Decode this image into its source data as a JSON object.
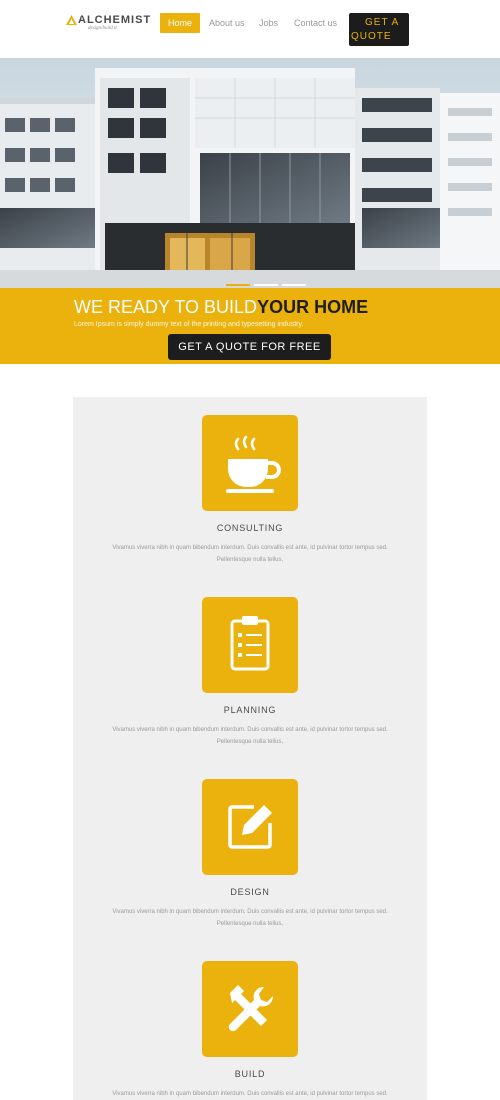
{
  "header": {
    "logo_name": "ALCHEMIST",
    "logo_tagline": "design/build it",
    "nav": [
      {
        "label": "Home",
        "active": true
      },
      {
        "label": "About us",
        "active": false
      },
      {
        "label": "Jobs",
        "active": false
      },
      {
        "label": "Contact us",
        "active": false
      }
    ],
    "quote_line1": "GET A",
    "quote_line2": "QUOTE"
  },
  "hero": {
    "image_desc_icon": "building-photo",
    "slide_indicators": 3
  },
  "banner": {
    "title_light": "WE READY TO BUILD",
    "title_dark": "YOUR HOME",
    "subtitle": "Lorem Ipsum is simply dummy text of the printing and typesetting industry.",
    "cta": "GET A QUOTE FOR FREE"
  },
  "services": [
    {
      "icon": "coffee-cup-icon",
      "title": "CONSULTING",
      "desc_line1": "Vivamus viverra nibh in quam bibendum interdum. Duis convallis est ante, id pulvinar tortor tempus sed.",
      "desc_line2": "Pellentesque nulla tellus,"
    },
    {
      "icon": "clipboard-icon",
      "title": "PLANNING",
      "desc_line1": "Vivamus viverra nibh in quam bibendum interdum. Duis convallis est ante, id pulvinar tortor tempus sed.",
      "desc_line2": "Pellentesque nulla tellus,"
    },
    {
      "icon": "edit-pencil-icon",
      "title": "DESIGN",
      "desc_line1": "Vivamus viverra nibh in quam bibendum interdum. Duis convallis est ante, id pulvinar tortor tempus sed.",
      "desc_line2": "Pellentesque nulla tellus,"
    },
    {
      "icon": "tools-icon",
      "title": "BUILD",
      "desc_line1": "Vivamus viverra nibh in quam bibendum interdum. Duis convallis est ante, id pulvinar tortor tempus sed.",
      "desc_line2": ""
    }
  ],
  "colors": {
    "accent": "#ebb10c",
    "dark": "#1d1d1d",
    "panel": "#efefef"
  }
}
